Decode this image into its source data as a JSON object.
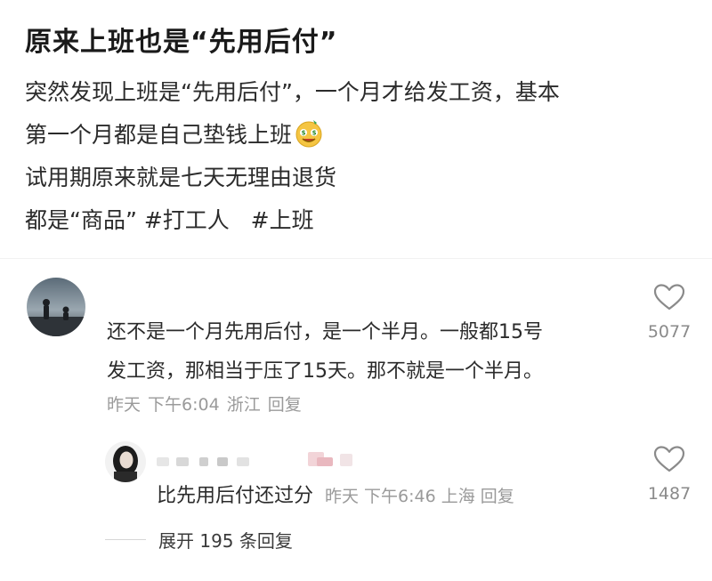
{
  "post": {
    "title": "原来上班也是“先用后付”",
    "body_line1": "突然发现上班是“先用后付”，一个月才给发工资，基本",
    "body_line2": "第一个月都是自己垫钱上班",
    "body_line3": "试用期原来就是七天无理由退货",
    "body_line4_prefix": "都是“商品”",
    "tag1": "#打工人",
    "tag2": "#上班",
    "emoji_icon": "money-face-emoji"
  },
  "comment": {
    "text_line1": "还不是一个月先用后付，是一个半月。一般都15号",
    "text_line2": "发工资，那相当于压了15天。那不就是一个半月。",
    "date": "昨天",
    "time": "下午6:04",
    "location": "浙江",
    "reply_label": "回复",
    "like_count": "5077"
  },
  "reply": {
    "text": "比先用后付还过分",
    "date": "昨天",
    "time": "下午6:46",
    "location": "上海",
    "reply_label": "回复",
    "like_count": "1487"
  },
  "expand": {
    "label": "展开 195 条回复"
  },
  "colors": {
    "text": "#2b2b2b",
    "meta": "#9a9a9a",
    "heart_outline": "#8a8a8a"
  }
}
